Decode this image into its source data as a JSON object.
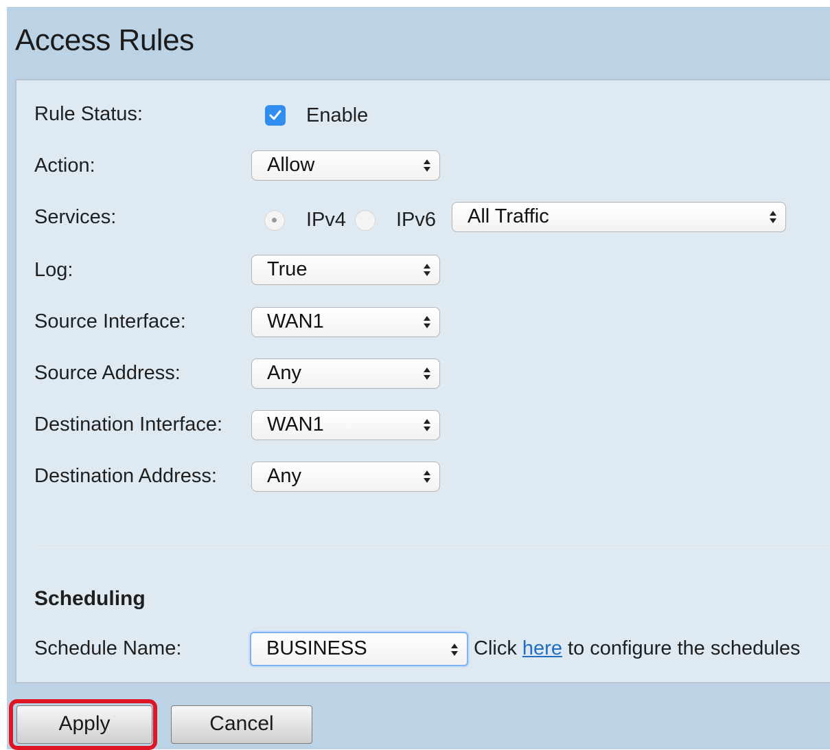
{
  "page": {
    "title": "Access Rules"
  },
  "form": {
    "rule_status": {
      "label": "Rule Status:",
      "checked": true,
      "option_label": "Enable"
    },
    "action": {
      "label": "Action:",
      "value": "Allow"
    },
    "services": {
      "label": "Services:",
      "ipv4_label": "IPv4",
      "ipv6_label": "IPv6",
      "selected_protocol": "IPv4",
      "value": "All Traffic"
    },
    "log": {
      "label": "Log:",
      "value": "True"
    },
    "source_interface": {
      "label": "Source Interface:",
      "value": "WAN1"
    },
    "source_address": {
      "label": "Source Address:",
      "value": "Any"
    },
    "destination_interface": {
      "label": "Destination Interface:",
      "value": "WAN1"
    },
    "destination_address": {
      "label": "Destination Address:",
      "value": "Any"
    }
  },
  "scheduling": {
    "title": "Scheduling",
    "schedule_name_label": "Schedule Name:",
    "schedule_value": "BUSINESS",
    "help_prefix": "Click",
    "help_link": "here",
    "help_suffix": "to configure the schedules"
  },
  "buttons": {
    "apply": "Apply",
    "cancel": "Cancel"
  },
  "colors": {
    "highlight": "#e01524",
    "checkbox": "#2f8ef0",
    "link": "#1f6ec2",
    "background": "#bcd3e6",
    "panel": "#dfe9f1"
  }
}
